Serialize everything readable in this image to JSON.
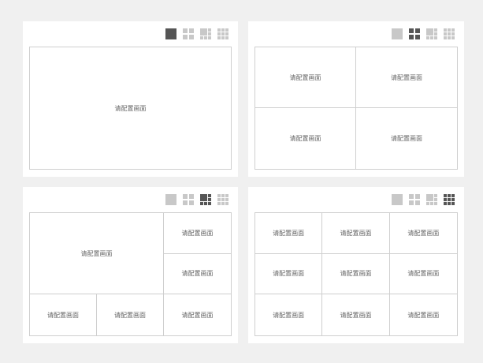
{
  "placeholder": "请配置画面",
  "layout_buttons": [
    "layout-1-icon",
    "layout-4-icon",
    "layout-6-icon",
    "layout-9-icon"
  ],
  "panels": [
    {
      "name": "single",
      "active_layout": "layout-1"
    },
    {
      "name": "quad",
      "active_layout": "layout-4"
    },
    {
      "name": "six",
      "active_layout": "layout-6"
    },
    {
      "name": "nine",
      "active_layout": "layout-9"
    }
  ],
  "colors": {
    "active": "#555555",
    "inactive": "#c8c8c8",
    "border": "#cfcfcf",
    "background": "#f0f0f0"
  }
}
